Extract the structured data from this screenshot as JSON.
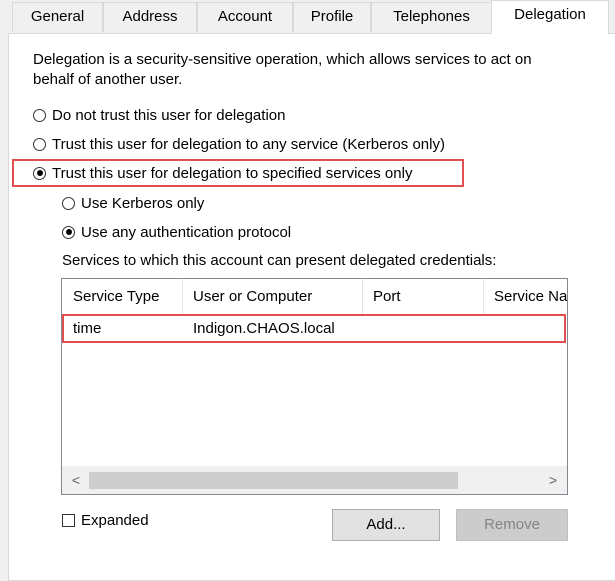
{
  "tabs": [
    {
      "label": "General"
    },
    {
      "label": "Address"
    },
    {
      "label": "Account"
    },
    {
      "label": "Profile"
    },
    {
      "label": "Telephones"
    },
    {
      "label": "Delegation"
    }
  ],
  "description": "Delegation is a security-sensitive operation, which allows services to act on behalf of another user.",
  "options": {
    "no_trust": "Do not trust this user for delegation",
    "any_service": "Trust this user for delegation to any service (Kerberos only)",
    "specified": "Trust this user for delegation to specified services only",
    "kerberos_only": "Use Kerberos only",
    "any_protocol": "Use any authentication protocol"
  },
  "services_label": "Services to which this account can present delegated credentials:",
  "table": {
    "columns": [
      "Service Type",
      "User or Computer",
      "Port",
      "Service Na"
    ],
    "rows": [
      {
        "service_type": "time",
        "user_or_computer": "Indigon.CHAOS.local",
        "port": "",
        "service_name": ""
      }
    ]
  },
  "scroll": {
    "left": "<",
    "right": ">"
  },
  "expanded_label": "Expanded",
  "buttons": {
    "add": "Add...",
    "remove": "Remove"
  },
  "colors": {
    "highlight": "#e05050"
  }
}
